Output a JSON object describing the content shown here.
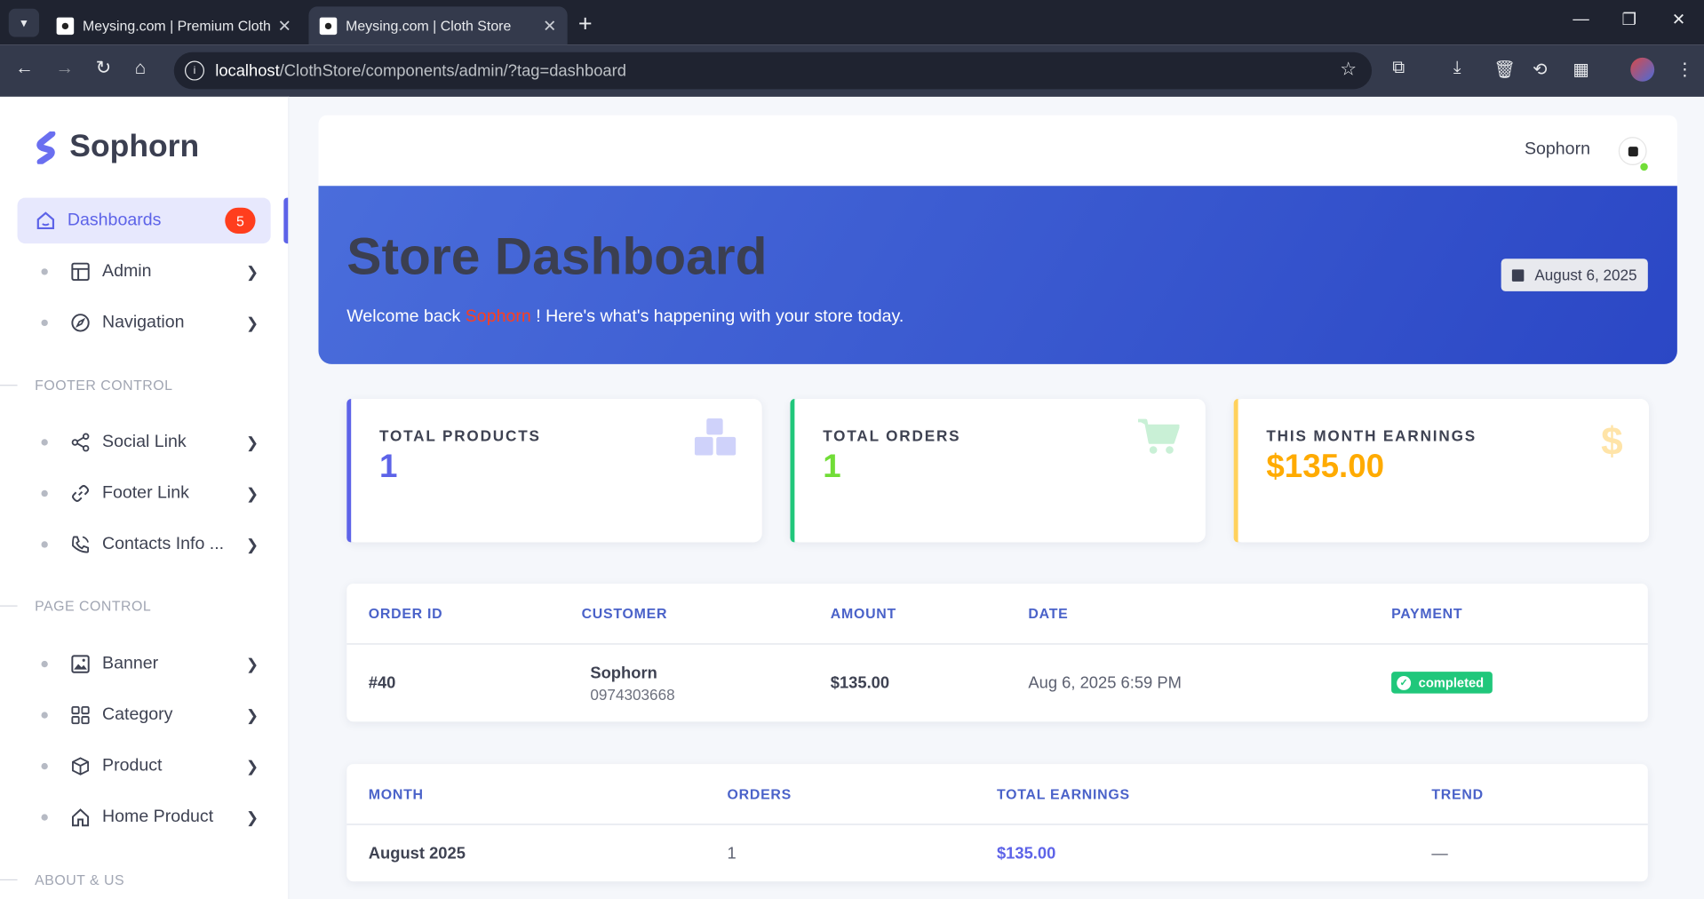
{
  "browser": {
    "tabs": [
      {
        "title": "Meysing.com | Premium Clothing"
      },
      {
        "title": "Meysing.com | Cloth Store"
      }
    ],
    "url_host": "localhost",
    "url_path": "/ClothStore/components/admin/?tag=dashboard"
  },
  "sidebar": {
    "brand": "Sophorn",
    "active": {
      "label": "Dashboards",
      "badge": "5"
    },
    "items_top": [
      {
        "label": "Admin",
        "icon": "layout-icon"
      },
      {
        "label": "Navigation",
        "icon": "compass-icon"
      }
    ],
    "section_footer": "FOOTER CONTROL",
    "items_footer": [
      {
        "label": "Social Link",
        "icon": "share-icon"
      },
      {
        "label": "Footer Link",
        "icon": "link-icon"
      },
      {
        "label": "Contacts Info ...",
        "icon": "phone-icon"
      }
    ],
    "section_page": "PAGE CONTROL",
    "items_page": [
      {
        "label": "Banner",
        "icon": "image-icon"
      },
      {
        "label": "Category",
        "icon": "grid-icon"
      },
      {
        "label": "Product",
        "icon": "box-icon"
      },
      {
        "label": "Home Product",
        "icon": "home-icon"
      }
    ],
    "section_about": "ABOUT & US"
  },
  "header": {
    "username": "Sophorn"
  },
  "hero": {
    "title": "Store Dashboard",
    "welcome_prefix": "Welcome back ",
    "welcome_name": "Sophorn",
    "welcome_suffix": " ! Here's what's happening with your store today.",
    "date": "August 6, 2025"
  },
  "stats": [
    {
      "label": "TOTAL PRODUCTS",
      "value": "1",
      "color": "#5d63e8",
      "icon": "boxes-icon"
    },
    {
      "label": "TOTAL ORDERS",
      "value": "1",
      "color": "#71dd37",
      "icon": "cart-icon"
    },
    {
      "label": "THIS MONTH EARNINGS",
      "value": "$135.00",
      "color": "#ffab00",
      "icon": "dollar-icon"
    }
  ],
  "orders": {
    "headers": [
      "ORDER ID",
      "CUSTOMER",
      "AMOUNT",
      "DATE",
      "PAYMENT"
    ],
    "row": {
      "id": "#40",
      "customer_name": "Sophorn",
      "customer_phone": "0974303668",
      "amount": "$135.00",
      "date": "Aug 6, 2025 6:59 PM",
      "payment": "completed"
    }
  },
  "monthly": {
    "headers": [
      "MONTH",
      "ORDERS",
      "TOTAL EARNINGS",
      "TREND"
    ],
    "row": {
      "month": "August 2025",
      "orders": "1",
      "earnings": "$135.00",
      "trend": "—"
    }
  },
  "colors": {
    "accent": "#5d63e8",
    "hero_start": "#4a6ddb",
    "hero_end": "#2b47c5",
    "success": "#20c77b",
    "danger": "#ff3e1d"
  }
}
